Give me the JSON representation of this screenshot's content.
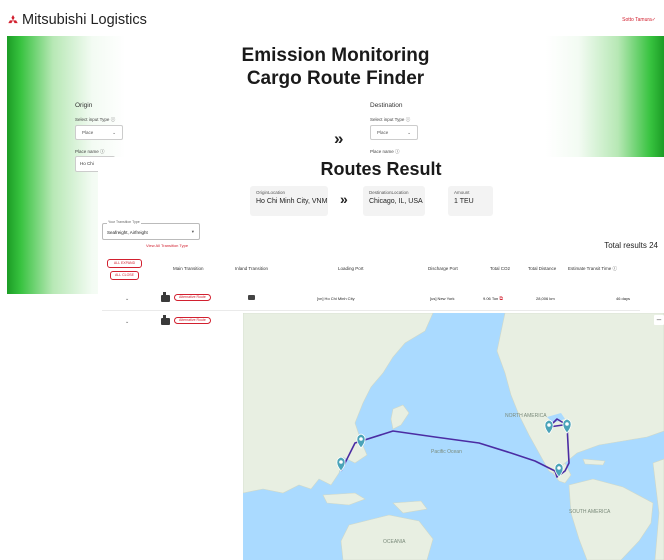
{
  "header": {
    "brand": "Mitsubishi Logistics",
    "user_link": "Sotto Tamura✓"
  },
  "finder": {
    "title_line1": "Emission Monitoring",
    "title_line2": "Cargo Route Finder",
    "origin": {
      "heading": "Origin",
      "input_type_label": "Select input Type ⓘ",
      "input_type_value": "Place",
      "place_label": "Place name ⓘ",
      "place_value": "Ho Chi"
    },
    "destination": {
      "heading": "Destination",
      "input_type_label": "Select input Type ⓘ",
      "input_type_value": "Place",
      "place_label": "Place name ⓘ"
    },
    "swap_icon": "»"
  },
  "results": {
    "title": "Routes Result",
    "origin_label": "OriginLocation",
    "origin_value": "Ho Chi Minh City, VNM",
    "arrow": "»",
    "destination_label": "DestinationLocation",
    "destination_value": "Chicago, IL, USA",
    "amount_label": "Amount",
    "amount_value": "1 TEU",
    "transition_type_legend": "Your Transition Type",
    "transition_type_value": "Seafreight, Airfreight",
    "view_all": "View All Transition Type",
    "total": "Total results 24",
    "expand_all": "ALL EXPAND",
    "close_all": "ALL CLOSE",
    "columns": [
      "Main Transition",
      "Inland Transition",
      "Loading Port",
      "Discharge Port",
      "Total CO2",
      "Total Distance",
      "Estimate Transit Time ⓘ"
    ],
    "rows": [
      {
        "badge": "Alternative Route",
        "loading_port": "[vn] Ho Chi Minh City",
        "discharge_port": "[us] New York",
        "co2": "9.06 Ton",
        "distance": "28,006 km",
        "transit": "46 days"
      },
      {
        "badge": "Alternative Route"
      }
    ]
  },
  "map": {
    "minimize": "–",
    "labels": {
      "north_america": "NORTH AMERICA",
      "south_america": "SOUTH AMERICA",
      "oceania": "OCEANIA",
      "pacific": "Pacific Ocean"
    },
    "colors": {
      "water": "#aadaff",
      "land": "#e8efe2",
      "route": "#4b2ca3",
      "marker": "#4aa3b8"
    }
  },
  "colors": {
    "brand_red": "#d2202f",
    "finder_green": "#1c9c26"
  }
}
